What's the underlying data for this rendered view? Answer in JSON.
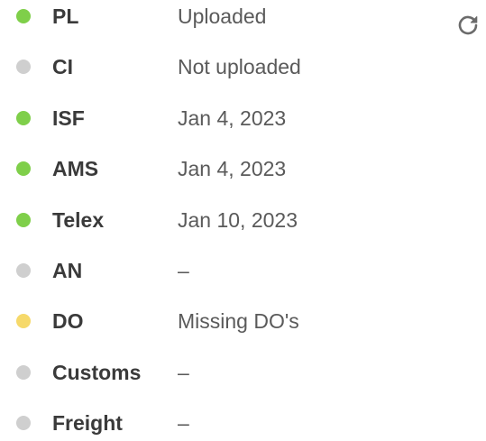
{
  "colors": {
    "complete": "#7fcf4a",
    "pending": "#cfcfcf",
    "warning": "#f6d96a",
    "label": "#3a3a3a",
    "value": "#5a5a5a",
    "icon": "#6b6b6b"
  },
  "refresh_icon": "refresh-icon",
  "rows": [
    {
      "label": "PL",
      "value": "Uploaded",
      "status": "complete"
    },
    {
      "label": "CI",
      "value": "Not uploaded",
      "status": "pending"
    },
    {
      "label": "ISF",
      "value": "Jan 4, 2023",
      "status": "complete"
    },
    {
      "label": "AMS",
      "value": "Jan 4, 2023",
      "status": "complete"
    },
    {
      "label": "Telex",
      "value": "Jan 10, 2023",
      "status": "complete"
    },
    {
      "label": "AN",
      "value": "–",
      "status": "pending"
    },
    {
      "label": "DO",
      "value": "Missing DO's",
      "status": "warning"
    },
    {
      "label": "Customs",
      "value": "–",
      "status": "pending"
    },
    {
      "label": "Freight",
      "value": "–",
      "status": "pending"
    }
  ]
}
